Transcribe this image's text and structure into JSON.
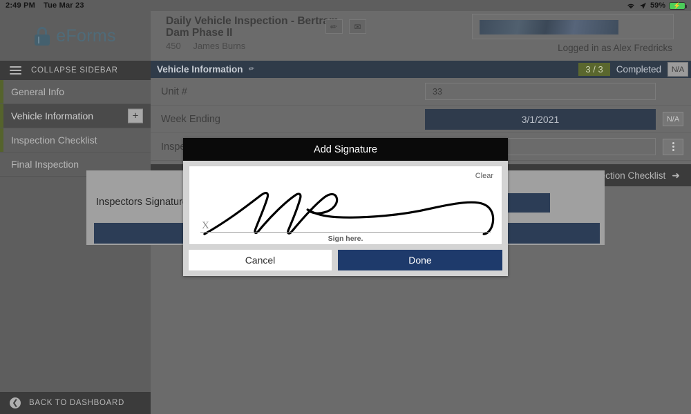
{
  "statusbar": {
    "time": "2:49 PM",
    "date": "Tue Mar 23",
    "wifi_icon": "wifi-icon",
    "location_icon": "location-arrow-icon",
    "battery_percent": "59%",
    "battery_icon": "battery-charging-icon"
  },
  "sidebar": {
    "brand": "eForms",
    "brand_icon": "lock-icon",
    "collapse_label": "COLLAPSE SIDEBAR",
    "menu_icon": "hamburger-icon",
    "items": [
      {
        "label": "General Info",
        "state": "done"
      },
      {
        "label": "Vehicle Information",
        "state": "active",
        "add_label": "+"
      },
      {
        "label": "Inspection Checklist",
        "state": "done"
      },
      {
        "label": "Final Inspection",
        "state": "plain"
      }
    ],
    "back_label": "BACK TO DASHBOARD",
    "back_icon": "back-arrow-circle-icon"
  },
  "header": {
    "title": "Daily Vehicle Inspection - Bertram Dam Phase II",
    "project_number": "450",
    "project_contact": "James  Burns",
    "edit_icon": "pencil-icon",
    "mail_icon": "envelope-icon",
    "logged_in": "Logged in as Alex Fredricks"
  },
  "section": {
    "title": "Vehicle Information",
    "edit_icon": "pencil-icon",
    "count": "3 / 3",
    "count_color": "#5a672e",
    "status": "Completed",
    "na_label": "N/A"
  },
  "form_rows": [
    {
      "label": "Unit #",
      "type": "text",
      "value": "33"
    },
    {
      "label": "Week Ending",
      "type": "date",
      "value": "3/1/2021",
      "na_label": "N/A"
    },
    {
      "label": "Inspector",
      "type": "text",
      "value": "",
      "kebab_icon": "vertical-dots-icon"
    }
  ],
  "nav_strip": {
    "next_label": "Inspection Checklist",
    "next_icon": "arrow-right-icon"
  },
  "under_dialog": {
    "signature_label": "Inspectors Signature"
  },
  "modal": {
    "title": "Add Signature",
    "clear_label": "Clear",
    "sign_hint": "Sign here.",
    "x_marker": "X",
    "cancel_label": "Cancel",
    "done_label": "Done",
    "done_color": "#1e3a6b"
  }
}
